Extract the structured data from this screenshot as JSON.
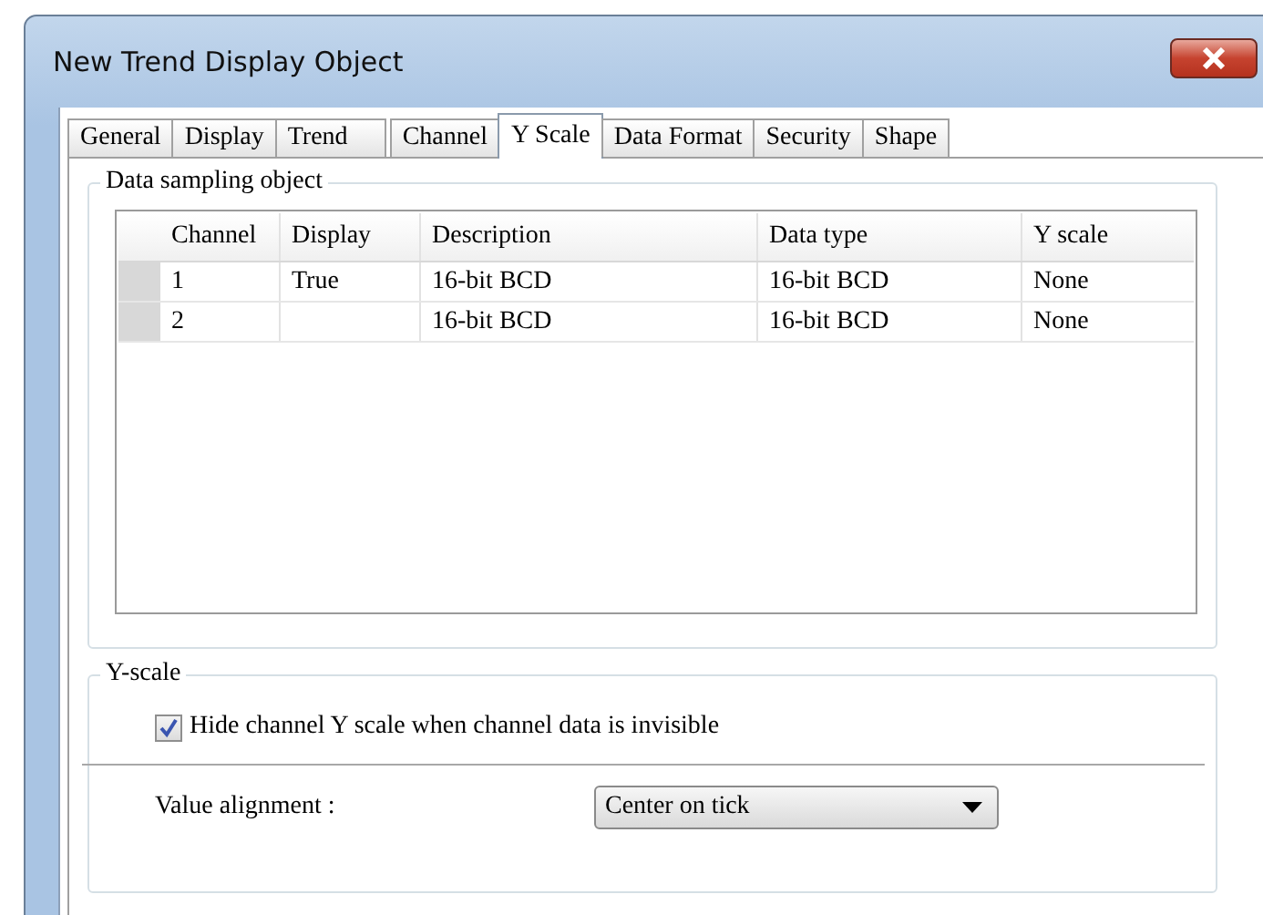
{
  "window": {
    "title": "New Trend Display Object"
  },
  "tabs": [
    {
      "label": "General",
      "selected": false
    },
    {
      "label": "Display",
      "selected": false
    },
    {
      "label": "Trend",
      "selected": false
    },
    {
      "label": "Channel",
      "selected": false
    },
    {
      "label": "Y Scale",
      "selected": true
    },
    {
      "label": "Data Format",
      "selected": false
    },
    {
      "label": "Security",
      "selected": false
    },
    {
      "label": "Shape",
      "selected": false
    }
  ],
  "sampling_group": {
    "title": "Data sampling object",
    "table": {
      "columns": [
        "Channel",
        "Display",
        "Description",
        "Data type",
        "Y scale"
      ],
      "rows": [
        [
          "1",
          "True",
          "16-bit BCD",
          "16-bit BCD",
          "None"
        ],
        [
          "2",
          "",
          "16-bit BCD",
          "16-bit BCD",
          "None"
        ]
      ]
    }
  },
  "y_scale_group": {
    "title": "Y-scale",
    "hide_checkbox": {
      "label": "Hide channel Y scale when channel data is invisible",
      "checked": true
    },
    "alignment": {
      "label": "Value alignment :",
      "value": "Center on tick"
    }
  }
}
